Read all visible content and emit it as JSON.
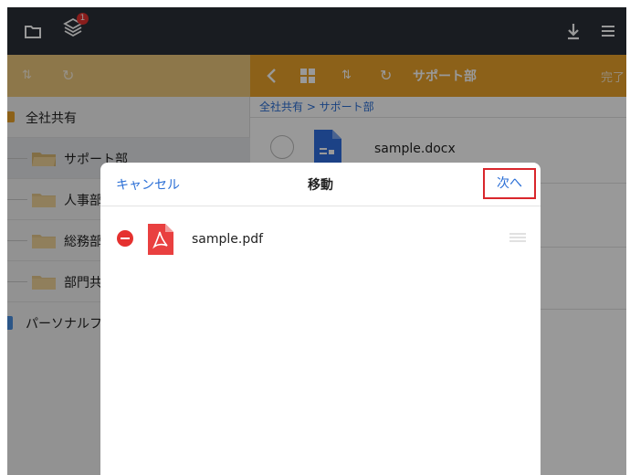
{
  "topbar": {
    "folder_icon": "folder-icon",
    "layers_icon": "layers-icon",
    "badge_count": "1",
    "download_icon": "download-icon",
    "menu_icon": "hamburger-menu-icon"
  },
  "left_toolbar": {
    "sort_icon": "sort-arrows-icon",
    "refresh_icon": "refresh-icon"
  },
  "right_toolbar": {
    "back_icon": "chevron-left-icon",
    "grid_icon": "grid-view-icon",
    "sort_icon": "sort-arrows-icon",
    "refresh_icon": "refresh-icon",
    "folder_title": "サポート部",
    "done_label": "完了"
  },
  "sidebar": {
    "items": [
      {
        "label": "全社共有",
        "level": 0,
        "selected": false
      },
      {
        "label": "サポート部",
        "level": 1,
        "selected": true
      },
      {
        "label": "人事部",
        "level": 1,
        "selected": false
      },
      {
        "label": "総務部",
        "level": 1,
        "selected": false
      },
      {
        "label": "部門共",
        "level": 1,
        "selected": false
      },
      {
        "label": "パーソナルフ",
        "level": 0,
        "selected": false
      }
    ]
  },
  "content": {
    "breadcrumb": "全社共有 > サポート部",
    "files": [
      {
        "name": "sample.docx",
        "icon": "word-document-icon"
      }
    ]
  },
  "modal": {
    "cancel_label": "キャンセル",
    "title": "移動",
    "next_label": "次へ",
    "files": [
      {
        "name": "sample.pdf",
        "icon": "pdf-file-icon"
      }
    ]
  },
  "colors": {
    "topbar": "#2b3038",
    "toolbar_orange": "#e9a22a",
    "toolbar_orange_light": "#ecc67c",
    "link_blue": "#2b6fd6",
    "delete_red": "#e5312f",
    "highlight_border": "#d9262c",
    "doc_blue": "#2f6fe0",
    "pdf_red": "#e94040"
  }
}
